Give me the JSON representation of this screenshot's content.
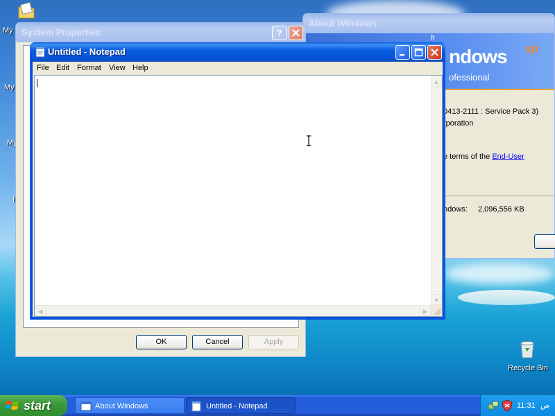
{
  "desktop": {
    "icons": [
      {
        "label": "My"
      },
      {
        "label": "My"
      },
      {
        "label": "My"
      },
      {
        "label": "I"
      }
    ],
    "recycle_bin": {
      "label": "Recycle Bin"
    }
  },
  "system_properties": {
    "title": "System Properties",
    "buttons": {
      "ok": "OK",
      "cancel": "Cancel",
      "apply": "Apply"
    }
  },
  "about_windows": {
    "title": "About Windows",
    "banner_word": "ndows",
    "banner_xp": "xp",
    "banner_edition": "ofessional",
    "banner_small": "ft",
    "version_line": "0413-2111 : Service Pack 3)",
    "corp_line": "rporation",
    "terms_prefix": "e terms of the ",
    "terms_link": "End-User",
    "memory_label": "ndows:",
    "memory_value": "2,096,556 KB"
  },
  "notepad": {
    "title": "Untitled - Notepad",
    "menu": [
      "File",
      "Edit",
      "Format",
      "View",
      "Help"
    ],
    "content": "",
    "colors": {
      "title_active": "#0a5ee0",
      "close": "#c4381f"
    }
  },
  "taskbar": {
    "start_label": "start",
    "tasks": [
      {
        "label": "About Windows",
        "active": false
      },
      {
        "label": "Untitled - Notepad",
        "active": true
      }
    ],
    "clock": "11:31",
    "clock_suffix": "ص"
  }
}
